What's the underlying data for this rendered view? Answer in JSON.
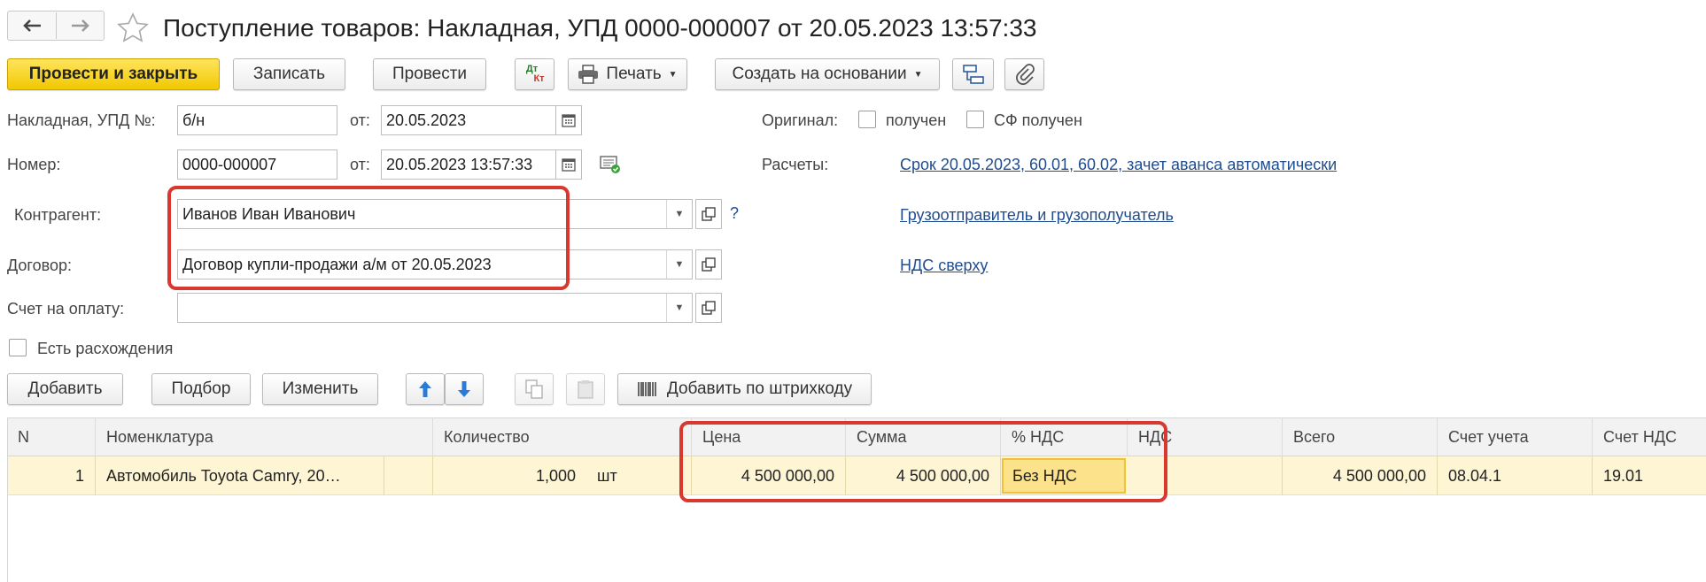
{
  "header": {
    "title": "Поступление товаров: Накладная, УПД 0000-000007 от 20.05.2023 13:57:33"
  },
  "toolbar": {
    "post_close": "Провести и закрыть",
    "save": "Записать",
    "post": "Провести",
    "dtkt_top": "Дт",
    "dtkt_bottom": "Кт",
    "print": "Печать",
    "create_based": "Создать на основании"
  },
  "form": {
    "invoice_label": "Накладная, УПД №:",
    "invoice_value": "б/н",
    "from_label": "от:",
    "invoice_date": "20.05.2023",
    "number_label": "Номер:",
    "number_value": "0000-000007",
    "number_date": "20.05.2023 13:57:33",
    "original_label": "Оригинал:",
    "received_label": "получен",
    "sf_received_label": "СФ получен",
    "settlements_label": "Расчеты:",
    "settlements_link": "Срок 20.05.2023, 60.01, 60.02, зачет аванса автоматически",
    "counterparty_label": "Контрагент:",
    "counterparty_value": "Иванов Иван Иванович",
    "help": "?",
    "shipper_link": "Грузоотправитель и грузополучатель",
    "contract_label": "Договор:",
    "contract_value": "Договор купли-продажи а/м от 20.05.2023",
    "vat_link": "НДС сверху",
    "invoice_pay_label": "Счет на оплату:",
    "invoice_pay_value": "",
    "discrepancy_label": "Есть расхождения"
  },
  "table_toolbar": {
    "add": "Добавить",
    "select": "Подбор",
    "edit": "Изменить",
    "barcode": "Добавить по штрихкоду"
  },
  "table": {
    "columns": [
      "N",
      "Номенклатура",
      "Количество",
      "Цена",
      "Сумма",
      "% НДС",
      "НДС",
      "Всего",
      "Счет учета",
      "Счет НДС"
    ],
    "rows": [
      {
        "n": "1",
        "item": "Автомобиль Toyota Camry, 20…",
        "qty": "1,000",
        "unit": "шт",
        "price": "4 500 000,00",
        "sum": "4 500 000,00",
        "vat_rate": "Без НДС",
        "vat": "",
        "total": "4 500 000,00",
        "account": "08.04.1",
        "vat_account": "19.01"
      }
    ]
  },
  "colors": {
    "primary_button": "#f1c800",
    "highlight_row": "#fdf5d3",
    "link": "#1f4d8f",
    "annotation": "#d9382f"
  }
}
